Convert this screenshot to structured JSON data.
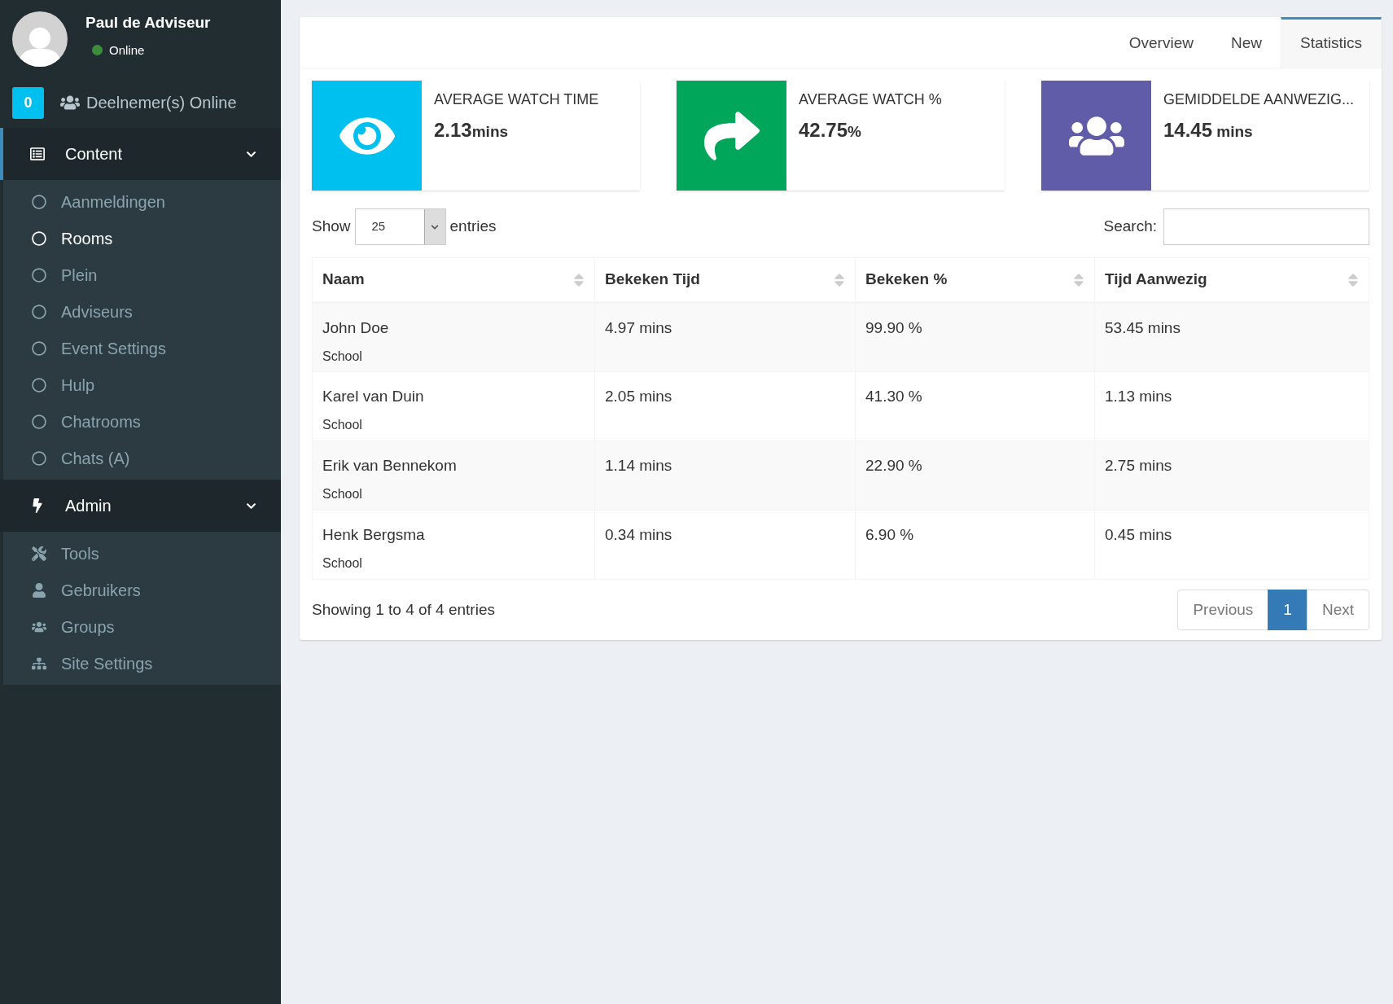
{
  "user": {
    "name": "Paul de Adviseur",
    "status": "Online",
    "online": true
  },
  "online_badge": {
    "count": "0",
    "label": "Deelnemer(s) Online"
  },
  "sidebar": {
    "sections": [
      {
        "label": "Content",
        "kind": "content",
        "expanded": true,
        "selected": true,
        "items": [
          {
            "label": "Aanmeldingen",
            "kind": "circle",
            "selected": false
          },
          {
            "label": "Rooms",
            "kind": "circle",
            "selected": true
          },
          {
            "label": "Plein",
            "kind": "circle",
            "selected": false
          },
          {
            "label": "Adviseurs",
            "kind": "circle",
            "selected": false
          },
          {
            "label": "Event Settings",
            "kind": "circle",
            "selected": false
          },
          {
            "label": "Hulp",
            "kind": "circle",
            "selected": false
          },
          {
            "label": "Chatrooms",
            "kind": "circle",
            "selected": false
          },
          {
            "label": "Chats (A)",
            "kind": "circle",
            "selected": false
          }
        ]
      },
      {
        "label": "Admin",
        "kind": "admin",
        "expanded": true,
        "selected": false,
        "items": [
          {
            "label": "Tools",
            "kind": "tools",
            "selected": false
          },
          {
            "label": "Gebruikers",
            "kind": "user",
            "selected": false
          },
          {
            "label": "Groups",
            "kind": "users",
            "selected": false
          },
          {
            "label": "Site Settings",
            "kind": "sitemap",
            "selected": false
          }
        ]
      }
    ]
  },
  "tabs": [
    {
      "label": "Overview",
      "selected": false
    },
    {
      "label": "New",
      "selected": false
    },
    {
      "label": "Statistics",
      "selected": true
    }
  ],
  "stats": [
    {
      "kind": "eye",
      "color": "#00c0ef",
      "title": "AVERAGE WATCH TIME",
      "value": "2.13",
      "unit": "mins"
    },
    {
      "kind": "share",
      "color": "#00a65a",
      "title": "AVERAGE WATCH %",
      "value": "42.75",
      "unit": "%"
    },
    {
      "kind": "users",
      "color": "#605ca8",
      "title": "GEMIDDELDE AANWEZIG...",
      "value": "14.45",
      "unit": " mins"
    }
  ],
  "length": {
    "label_before": "Show",
    "value": "25",
    "label_after": "entries"
  },
  "search": {
    "label": "Search:"
  },
  "table": {
    "columns": [
      "Naam",
      "Bekeken Tijd",
      "Bekeken %",
      "Tijd Aanwezig"
    ],
    "rows": [
      {
        "name": "John Doe",
        "group": "School",
        "time": "4.97 mins",
        "percent": "99.90 %",
        "present": "53.45 mins"
      },
      {
        "name": "Karel van Duin",
        "group": "School",
        "time": "2.05 mins",
        "percent": "41.30 %",
        "present": "1.13 mins"
      },
      {
        "name": "Erik van Bennekom",
        "group": "School",
        "time": "1.14 mins",
        "percent": "22.90 %",
        "present": "2.75 mins"
      },
      {
        "name": "Henk Bergsma",
        "group": "School",
        "time": "0.34 mins",
        "percent": "6.90 %",
        "present": "0.45 mins"
      }
    ]
  },
  "info": "Showing 1 to 4 of 4 entries",
  "pagination": [
    {
      "label": "Previous",
      "selected": false
    },
    {
      "label": "1",
      "selected": true
    },
    {
      "label": "Next",
      "selected": false
    }
  ]
}
